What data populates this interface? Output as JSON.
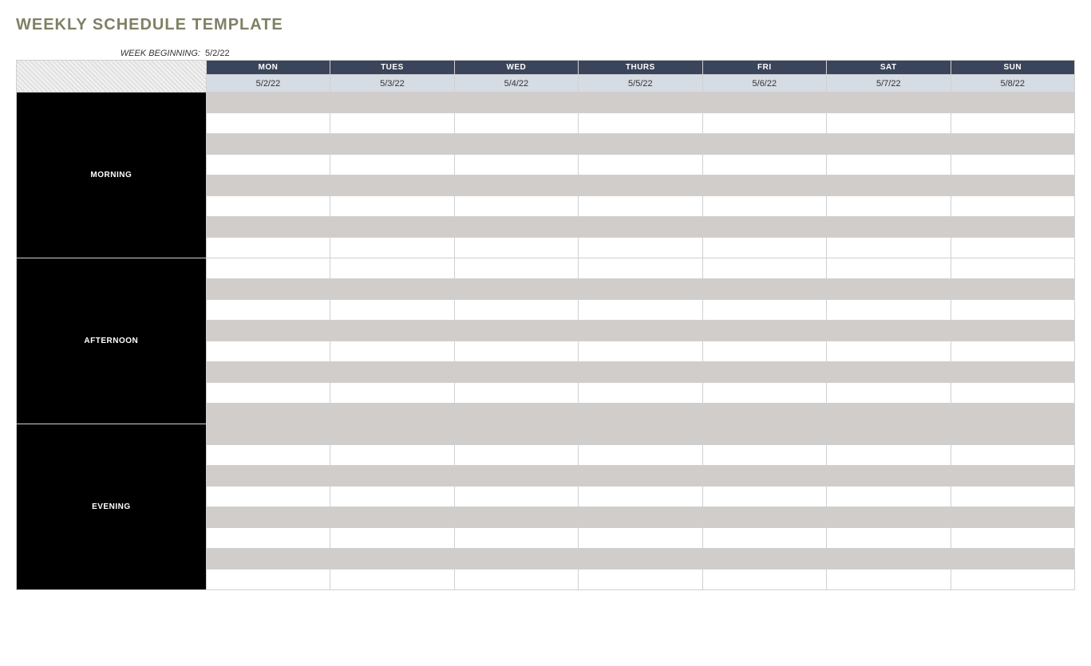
{
  "title": "WEEKLY SCHEDULE TEMPLATE",
  "week_beginning_label": "WEEK BEGINNING:",
  "week_beginning_value": "5/2/22",
  "days": [
    {
      "name": "MON",
      "date": "5/2/22"
    },
    {
      "name": "TUES",
      "date": "5/3/22"
    },
    {
      "name": "WED",
      "date": "5/4/22"
    },
    {
      "name": "THURS",
      "date": "5/5/22"
    },
    {
      "name": "FRI",
      "date": "5/6/22"
    },
    {
      "name": "SAT",
      "date": "5/7/22"
    },
    {
      "name": "SUN",
      "date": "5/8/22"
    }
  ],
  "periods": [
    {
      "label": "MORNING",
      "rows": 8
    },
    {
      "label": "AFTERNOON",
      "rows": 8
    },
    {
      "label": "EVENING",
      "rows": 8
    }
  ]
}
